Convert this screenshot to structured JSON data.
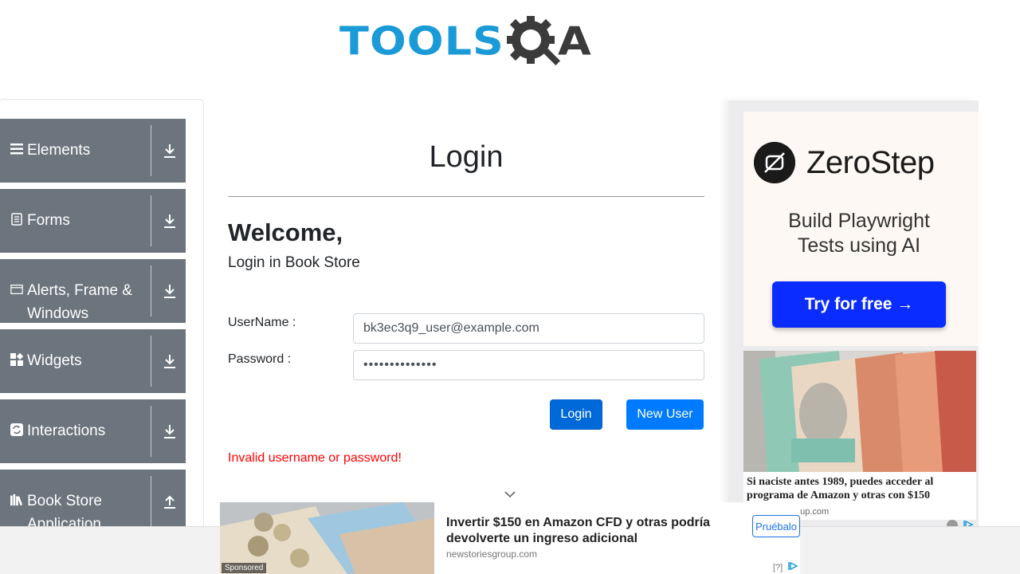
{
  "header": {
    "logo_text": "TOOLS",
    "logo_a": "A"
  },
  "sidebar": {
    "groups": [
      {
        "label": "Elements",
        "icon": "list-icon",
        "toggle": "download-arrow-icon"
      },
      {
        "label": "Forms",
        "icon": "form-icon",
        "toggle": "download-arrow-icon"
      },
      {
        "label": "Alerts, Frame & Windows",
        "icon": "window-icon",
        "toggle": "download-arrow-icon"
      },
      {
        "label": "Widgets",
        "icon": "widgets-icon",
        "toggle": "download-arrow-icon"
      },
      {
        "label": "Interactions",
        "icon": "interactions-icon",
        "toggle": "download-arrow-icon"
      },
      {
        "label": "Book Store Application",
        "icon": "books-icon",
        "toggle": "upload-arrow-icon"
      }
    ]
  },
  "main": {
    "title": "Login",
    "welcome": "Welcome,",
    "subtitle": "Login in Book Store",
    "username_label": "UserName :",
    "username_value": "bk3ec3q9_user@example.com",
    "password_label": "Password :",
    "password_value": "••••••••••••••",
    "login_button": "Login",
    "new_user_button": "New User",
    "error_message": "Invalid username or password!"
  },
  "ad_right": {
    "brand": "ZeroStep",
    "tagline_line1": "Build Playwright",
    "tagline_line2": "Tests using AI",
    "cta": "Try for free →",
    "caption": "Si naciste antes 1989, puedes acceder al programa de Amazon y otras con $150",
    "domain": "oup.com"
  },
  "ad_bottom": {
    "sponsored": "Sponsored",
    "title": "Invertir $150 en Amazon CFD y otras podría devolverte un ingreso adicional",
    "domain": "newstoriesgroup.com",
    "button": "Pruébalo",
    "help": "[?]"
  },
  "colors": {
    "accent": "#007bff",
    "login_button": "#0069d9",
    "sidebar_group": "#6c757d",
    "error": "#ff0000",
    "logo_blue": "#1a9ad6",
    "zerostep_cta": "#0a2cff"
  }
}
